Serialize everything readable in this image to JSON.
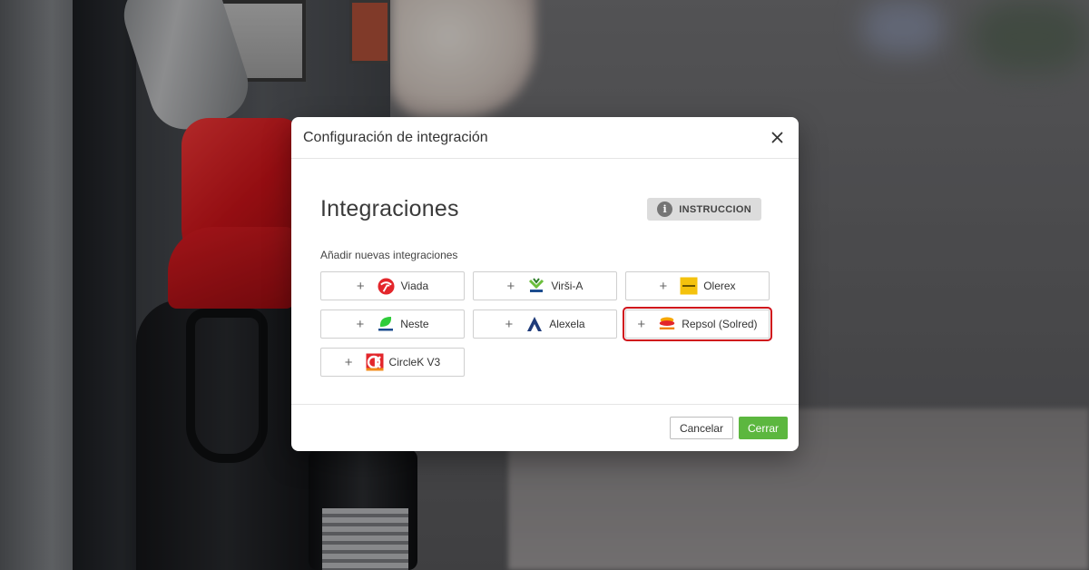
{
  "modal": {
    "title": "Configuración de integración",
    "close_icon": "close-icon"
  },
  "section": {
    "title": "Integraciones",
    "instruction_label": "INSTRUCCION",
    "instruction_icon": "info-icon",
    "info_glyph": "i",
    "add_label": "Añadir nuevas integraciones"
  },
  "integrations": [
    {
      "label": "Viada",
      "icon": "viada-logo-icon",
      "highlighted": false
    },
    {
      "label": "Virši-A",
      "icon": "virsi-logo-icon",
      "highlighted": false
    },
    {
      "label": "Olerex",
      "icon": "olerex-logo-icon",
      "highlighted": false
    },
    {
      "label": "Neste",
      "icon": "neste-logo-icon",
      "highlighted": false
    },
    {
      "label": "Alexela",
      "icon": "alexela-logo-icon",
      "highlighted": false
    },
    {
      "label": "Repsol (Solred)",
      "icon": "repsol-logo-icon",
      "highlighted": true
    },
    {
      "label": "CircleK V3",
      "icon": "circlek-logo-icon",
      "highlighted": false
    }
  ],
  "plus_glyph": "+",
  "footer": {
    "cancel_label": "Cancelar",
    "close_label": "Cerrar"
  },
  "colors": {
    "accent_green": "#5cb73f",
    "highlight_red": "#d0121b",
    "instruction_bg": "#dcdcdc"
  }
}
